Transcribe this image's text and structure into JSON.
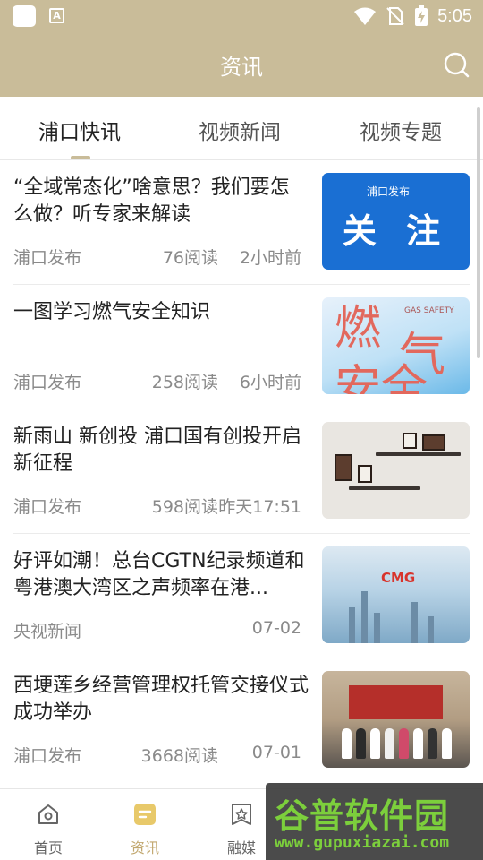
{
  "status_bar": {
    "time": "5:05",
    "app_indicator": "A"
  },
  "header": {
    "title": "资讯"
  },
  "tabs": [
    {
      "label": "浦口快讯",
      "active": true
    },
    {
      "label": "视频新闻",
      "active": false
    },
    {
      "label": "视频专题",
      "active": false
    }
  ],
  "news": [
    {
      "title": "“全域常态化”啥意思？我们要怎么做？听专家来解读",
      "source": "浦口发布",
      "reads": "76阅读",
      "time": "2小时前",
      "thumb_text": "关 注",
      "thumb_logo": "浦口发布"
    },
    {
      "title": "一图学习燃气安全知识",
      "source": "浦口发布",
      "reads": "258阅读",
      "time": "6小时前",
      "thumb_text": "GAS SAFETY"
    },
    {
      "title": "新雨山 新创投 浦口国有创投开启新征程",
      "source": "浦口发布",
      "reads": "598阅读",
      "time": "昨天17:51"
    },
    {
      "title": "好评如潮！总台CGTN纪录频道和粤港澳大湾区之声频率在港...",
      "source": "央视新闻",
      "reads": "",
      "time": "07-02",
      "thumb_text": "CMG"
    },
    {
      "title": "西埂莲乡经营管理权托管交接仪式成功举办",
      "source": "浦口发布",
      "reads": "3668阅读",
      "time": "07-01"
    }
  ],
  "bottom_nav": [
    {
      "label": "首页",
      "icon": "home-icon",
      "active": false
    },
    {
      "label": "资讯",
      "icon": "news-icon",
      "active": true
    },
    {
      "label": "融媒",
      "icon": "star-media-icon",
      "active": false
    }
  ],
  "watermark": {
    "main": "谷普软件园",
    "url": "www.gupuxiazai.com"
  },
  "colors": {
    "brand": "#c9bc99",
    "active_nav": "#c1a76e",
    "thumb_blue": "#1a6fd3"
  }
}
